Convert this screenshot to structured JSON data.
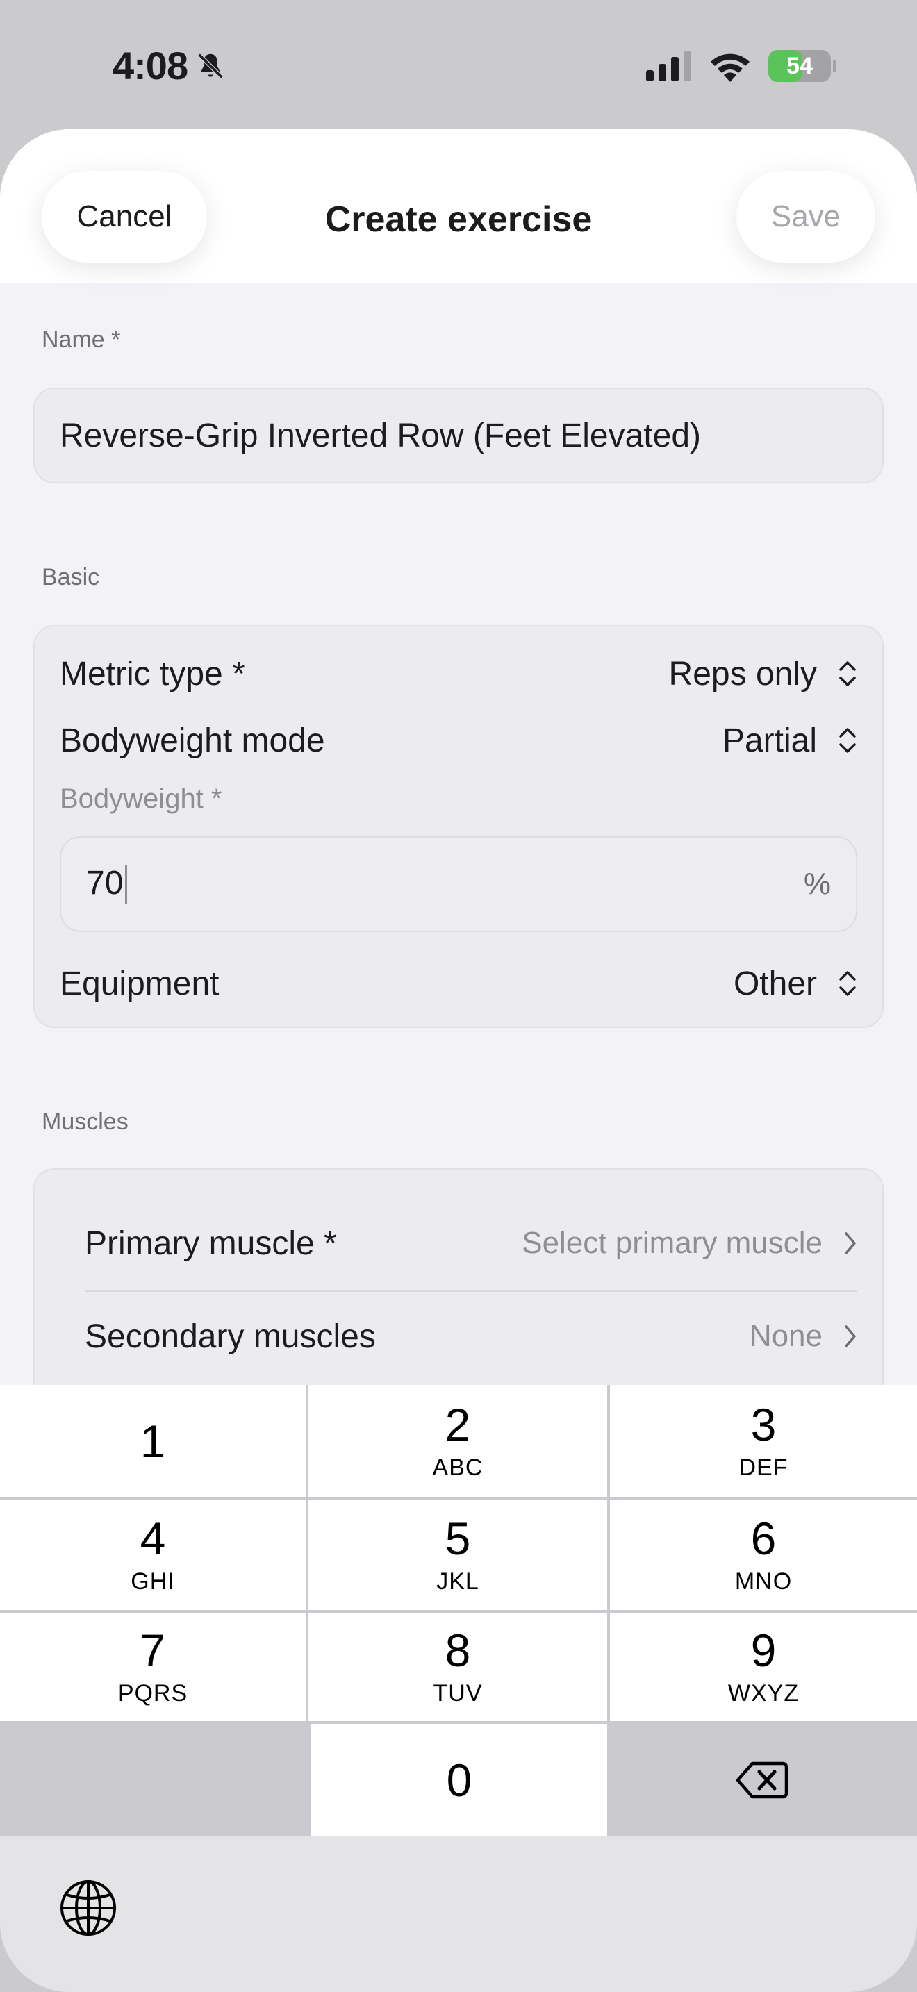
{
  "status_bar": {
    "time": "4:08",
    "battery": "54",
    "battery_level": 54
  },
  "sheet": {
    "title": "Create exercise",
    "cancel_label": "Cancel",
    "save_label": "Save"
  },
  "name_section": {
    "label": "Name *",
    "value": "Reverse-Grip Inverted Row (Feet Elevated)"
  },
  "basic_section": {
    "label": "Basic",
    "metric_type": {
      "label": "Metric type *",
      "value": "Reps only"
    },
    "bodyweight_mode": {
      "label": "Bodyweight mode",
      "value": "Partial"
    },
    "bodyweight": {
      "label": "Bodyweight *",
      "value": "70",
      "unit": "%"
    },
    "equipment": {
      "label": "Equipment",
      "value": "Other"
    }
  },
  "muscles_section": {
    "label": "Muscles",
    "primary": {
      "label": "Primary muscle *",
      "value": "Select primary muscle"
    },
    "secondary": {
      "label": "Secondary muscles",
      "value": "None"
    }
  },
  "keypad": {
    "keys": [
      {
        "num": "1",
        "letters": ""
      },
      {
        "num": "2",
        "letters": "ABC"
      },
      {
        "num": "3",
        "letters": "DEF"
      },
      {
        "num": "4",
        "letters": "GHI"
      },
      {
        "num": "5",
        "letters": "JKL"
      },
      {
        "num": "6",
        "letters": "MNO"
      },
      {
        "num": "7",
        "letters": "PQRS"
      },
      {
        "num": "8",
        "letters": "TUV"
      },
      {
        "num": "9",
        "letters": "WXYZ"
      },
      {
        "num": "0",
        "letters": ""
      }
    ]
  },
  "icons": {
    "mute": "bell-slash-icon",
    "signal": "cellular-signal-icon",
    "wifi": "wifi-icon",
    "battery": "battery-charging-icon",
    "picker": "chevron-up-down-icon",
    "disclosure": "chevron-right-icon",
    "delete": "backspace-icon",
    "globe": "globe-icon"
  }
}
